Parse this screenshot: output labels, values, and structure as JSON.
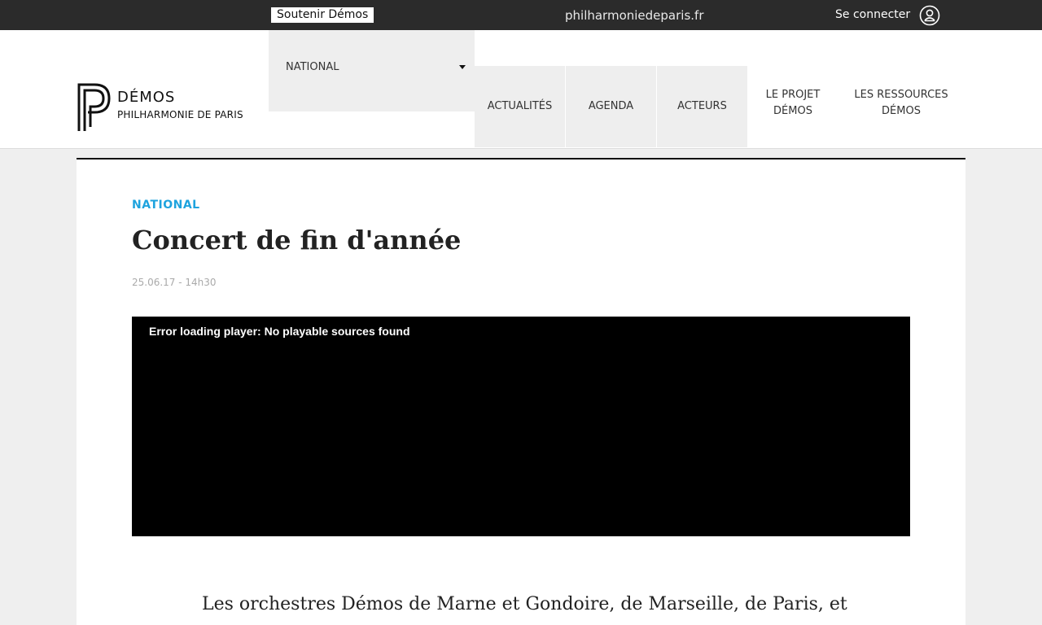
{
  "topbar": {
    "support_label": "Soutenir Démos",
    "site_link": "philharmoniedeparis.fr",
    "login_label": "Se connecter",
    "login_icon": "user-circle-icon"
  },
  "header": {
    "logo": {
      "title": "DÉMOS",
      "subtitle": "PHILHARMONIE DE PARIS"
    },
    "region_select": {
      "value": "NATIONAL"
    },
    "nav": [
      {
        "label": "ACTUALITÉS"
      },
      {
        "label": "AGENDA"
      },
      {
        "label": "ACTEURS"
      },
      {
        "label_line1": "LE PROJET",
        "label_line2": "DÉMOS"
      },
      {
        "label_line1": "LES RESSOURCES",
        "label_line2": "DÉMOS"
      }
    ]
  },
  "article": {
    "category": "NATIONAL",
    "title": "Concert de fin d'année",
    "date": "25.06.17 - 14h30",
    "player_error": "Error loading player: No playable sources found",
    "intro": "Les orchestres Démos de Marne et Gondoire, de Marseille, de Paris, et"
  },
  "colors": {
    "topbar_bg": "#2b2b2b",
    "accent": "#1ea3de",
    "page_bg": "#efefef"
  }
}
